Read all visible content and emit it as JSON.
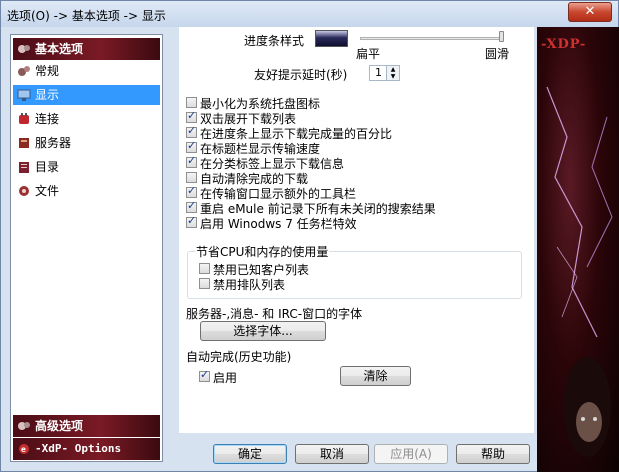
{
  "window": {
    "title": "选项(O) -> 基本选项 -> 显示",
    "close_glyph": "✕"
  },
  "sidebar": {
    "sections": [
      {
        "label": "基本选项",
        "icon": "basic-options-icon"
      },
      {
        "label": "高级选项",
        "icon": "advanced-options-icon"
      },
      {
        "label": "-XdP- Options",
        "icon": "xdp-options-icon"
      }
    ],
    "items": [
      {
        "label": "常规",
        "icon": "general-icon",
        "active": false
      },
      {
        "label": "显示",
        "icon": "display-icon",
        "active": true
      },
      {
        "label": "连接",
        "icon": "connection-icon",
        "active": false
      },
      {
        "label": "服务器",
        "icon": "server-icon",
        "active": false
      },
      {
        "label": "目录",
        "icon": "directory-icon",
        "active": false
      },
      {
        "label": "文件",
        "icon": "files-icon",
        "active": false
      }
    ]
  },
  "progress_style": {
    "label": "进度条样式",
    "slider_min_label": "扁平",
    "slider_max_label": "圆滑",
    "slider_value": 1.0
  },
  "tooltip_delay": {
    "label": "友好提示延时(秒)",
    "value": "1"
  },
  "checkboxes": [
    {
      "label": "最小化为系统托盘图标",
      "checked": false
    },
    {
      "label": "双击展开下载列表",
      "checked": true
    },
    {
      "label": "在进度条上显示下载完成量的百分比",
      "checked": true
    },
    {
      "label": "在标题栏显示传输速度",
      "checked": true
    },
    {
      "label": "在分类标签上显示下载信息",
      "checked": true
    },
    {
      "label": "自动清除完成的下载",
      "checked": false
    },
    {
      "label": "在传输窗口显示额外的工具栏",
      "checked": true
    },
    {
      "label": "重启 eMule 前记录下所有未关闭的搜索结果",
      "checked": true
    },
    {
      "label": "启用 Winodws 7 任务栏特效",
      "checked": true
    }
  ],
  "cpu_group": {
    "title": "节省CPU和内存的使用量",
    "items": [
      {
        "label": "禁用已知客户列表",
        "checked": false
      },
      {
        "label": "禁用排队列表",
        "checked": false
      }
    ]
  },
  "font_section": {
    "label": "服务器-,消息- 和 IRC-窗口的字体",
    "button": "选择字体..."
  },
  "autocomplete": {
    "label": "自动完成(历史功能)",
    "enable_label": "启用",
    "enable_checked": true,
    "clear_button": "清除"
  },
  "buttons": {
    "ok": "确定",
    "cancel": "取消",
    "apply": "应用(A)",
    "help": "帮助"
  },
  "art": {
    "logo_text": "-XDP-"
  }
}
